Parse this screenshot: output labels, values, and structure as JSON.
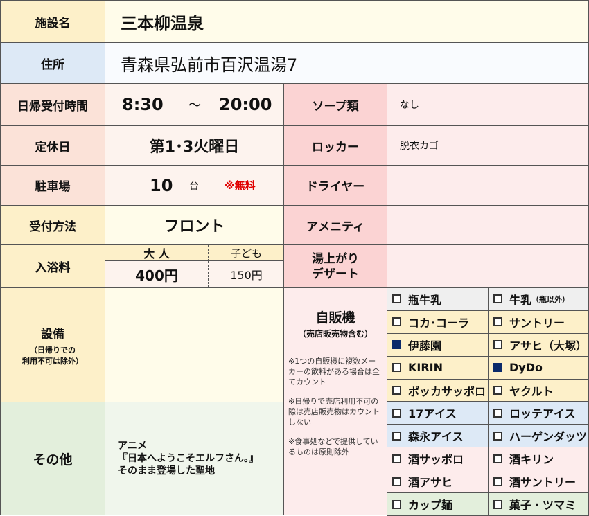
{
  "facility": {
    "label": "施設名",
    "value": "三本柳温泉"
  },
  "address": {
    "label": "住所",
    "value": "青森県弘前市百沢温湯7"
  },
  "hours": {
    "label": "日帰受付時間",
    "open": "8:30",
    "sep": "～",
    "close": "20:00"
  },
  "closed": {
    "label": "定休日",
    "value": "第1･3火曜日"
  },
  "parking": {
    "label": "駐車場",
    "count": "10",
    "unit": "台",
    "note": "※無料"
  },
  "reception": {
    "label": "受付方法",
    "value": "フロント"
  },
  "fee": {
    "label": "入浴料",
    "adult_label": "大 人",
    "adult": "400円",
    "child_label": "子ども",
    "child": "150円"
  },
  "soap": {
    "label": "ソープ類",
    "value": "なし"
  },
  "locker": {
    "label": "ロッカー",
    "value": "脱衣カゴ"
  },
  "dryer": {
    "label": "ドライヤー",
    "value": ""
  },
  "amenity": {
    "label": "アメニティ",
    "value": ""
  },
  "dessert": {
    "label1": "湯上がり",
    "label2": "デザート",
    "value": ""
  },
  "equipment": {
    "label": "設備",
    "sub1": "（日帰りでの",
    "sub2": "利用不可は除外）",
    "value": ""
  },
  "other": {
    "label": "その他",
    "line1": "アニメ",
    "line2": "『日本へようこそエルフさん。』",
    "line3": "そのまま登場した聖地"
  },
  "vending": {
    "title": "自販機",
    "subtitle": "（売店販売物含む）",
    "note1": "※1つの自販機に複数メーカーの飲料がある場合は全てカウント",
    "note2": "※日帰りで売店利用不可の際は売店販売物はカウントしない",
    "note3": "※食事処などで提供しているものは原則除外",
    "items": [
      {
        "name": "瓶牛乳",
        "suffix": "",
        "checked": false,
        "color": "#efefef"
      },
      {
        "name": "牛乳",
        "suffix": "（瓶以外）",
        "checked": false,
        "color": "#efefef"
      },
      {
        "name": "コカ･コーラ",
        "suffix": "",
        "checked": false,
        "color": "#fdf0c9"
      },
      {
        "name": "サントリー",
        "suffix": "",
        "checked": false,
        "color": "#fdf0c9"
      },
      {
        "name": "伊藤園",
        "suffix": "",
        "checked": true,
        "color": "#fdf0c9"
      },
      {
        "name": "アサヒ（大塚）",
        "suffix": "",
        "checked": false,
        "color": "#fdf0c9"
      },
      {
        "name": "KIRIN",
        "suffix": "",
        "checked": false,
        "color": "#fdf0c9"
      },
      {
        "name": "DyDo",
        "suffix": "",
        "checked": true,
        "color": "#fdf0c9"
      },
      {
        "name": "ポッカサッポロ",
        "suffix": "",
        "checked": false,
        "color": "#fdf0c9"
      },
      {
        "name": "ヤクルト",
        "suffix": "",
        "checked": false,
        "color": "#fdf0c9"
      },
      {
        "name": "17アイス",
        "suffix": "",
        "checked": false,
        "color": "#dde9f6"
      },
      {
        "name": "ロッテアイス",
        "suffix": "",
        "checked": false,
        "color": "#dde9f6"
      },
      {
        "name": "森永アイス",
        "suffix": "",
        "checked": false,
        "color": "#dde9f6"
      },
      {
        "name": "ハーゲンダッツ",
        "suffix": "",
        "checked": false,
        "color": "#dde9f6"
      },
      {
        "name": "酒サッポロ",
        "suffix": "",
        "checked": false,
        "color": "#fdecec"
      },
      {
        "name": "酒キリン",
        "suffix": "",
        "checked": false,
        "color": "#fdecec"
      },
      {
        "name": "酒アサヒ",
        "suffix": "",
        "checked": false,
        "color": "#fdecec"
      },
      {
        "name": "酒サントリー",
        "suffix": "",
        "checked": false,
        "color": "#fdecec"
      },
      {
        "name": "カップ麺",
        "suffix": "",
        "checked": false,
        "color": "#e3efdc"
      },
      {
        "name": "菓子・ツマミ",
        "suffix": "",
        "checked": false,
        "color": "#e3efdc"
      }
    ]
  }
}
